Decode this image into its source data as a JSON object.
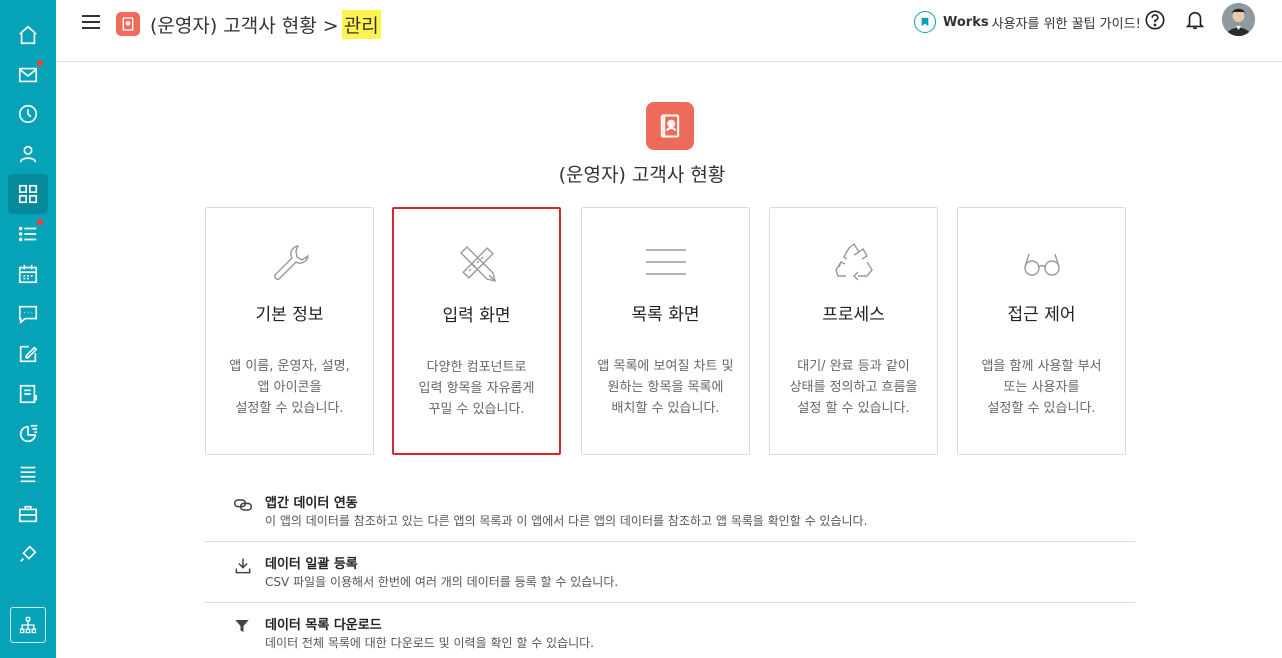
{
  "header": {
    "breadcrumb_app": "(운영자) 고객사 현황 >",
    "breadcrumb_current": "관리",
    "guide_bold": "Works",
    "guide_text": "사용자를 위한 꿀팁 가이드!"
  },
  "hero": {
    "title": "(운영자) 고객사 현황"
  },
  "cards": [
    {
      "title": "기본 정보",
      "desc": "앱 이름, 운영자, 설명,\n앱 아이콘을\n설정할 수 있습니다.",
      "icon": "wrench-icon"
    },
    {
      "title": "입력 화면",
      "desc": "다양한 컴포넌트로\n입력 항목을 자유롭게\n꾸밀 수 있습니다.",
      "icon": "pencil-ruler-icon"
    },
    {
      "title": "목록 화면",
      "desc": "앱 목록에 보여질 차트 및\n원하는 항목을 목록에\n배치할 수 있습니다.",
      "icon": "list-lines-icon"
    },
    {
      "title": "프로세스",
      "desc": "대기/ 완료 등과 같이\n상태를 정의하고 흐름을\n설정 할 수 있습니다.",
      "icon": "recycle-icon"
    },
    {
      "title": "접근 제어",
      "desc": "앱을 함께 사용할 부서\n또는 사용자를\n설정할 수 있습니다.",
      "icon": "glasses-icon"
    }
  ],
  "rows": [
    {
      "title": "앱간 데이터 연동",
      "desc": "이 앱의 데이터를 참조하고 있는 다른 앱의 목록과 이 앱에서 다른 앱의 데이터를 참조하고 앱 목록을 확인할 수 있습니다.",
      "icon": "link-icon"
    },
    {
      "title": "데이터 일괄 등록",
      "desc": "CSV 파일을 이용해서 한번에 여러 개의 데이터를 등록 할 수 있습니다.",
      "icon": "upload-icon"
    },
    {
      "title": "데이터 목록 다운로드",
      "desc": "데이터 전체 목록에 대한 다운로드 및 이력을 확인 할 수 있습니다.",
      "icon": "filter-icon"
    }
  ],
  "colors": {
    "sidebar": "#06a3b8",
    "accent_app": "#ee6b5b",
    "highlight": "#fff44f",
    "selected_border": "#d9262c"
  }
}
